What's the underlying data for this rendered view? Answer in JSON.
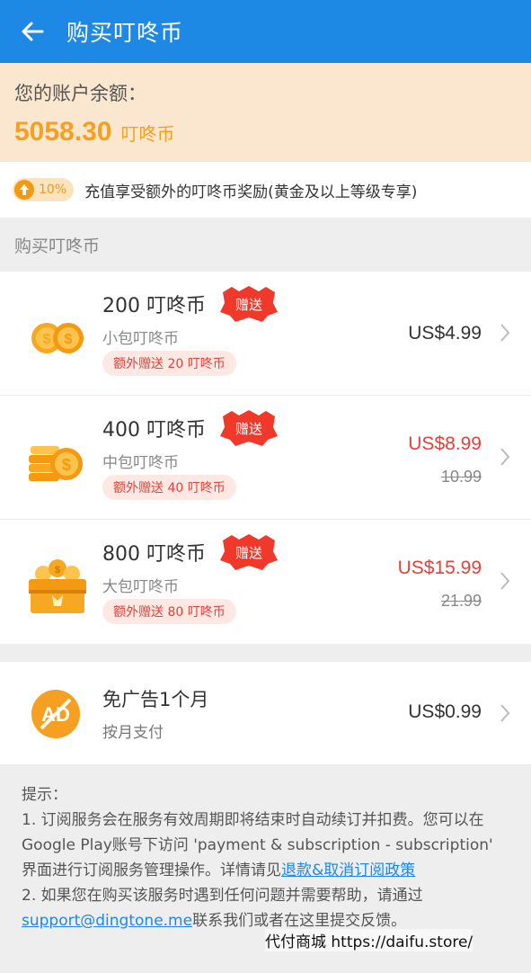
{
  "appbar": {
    "title": "购买叮咚币",
    "back_icon": "arrow-left-icon"
  },
  "balance": {
    "label": "您的账户余额：",
    "amount": "5058.30",
    "unit": "叮咚币"
  },
  "bonus": {
    "badge_percent": "10%",
    "badge_icon": "arrow-up-icon",
    "text": "充值享受额外的叮咚币奖励(黄金及以上等级专享)"
  },
  "section": {
    "title": "购买叮咚币"
  },
  "packages": [
    {
      "name": "200 叮咚币",
      "gift_label": "赠送",
      "subtitle": "小包叮咚币",
      "extra": "额外赠送 20 叮咚币",
      "price": "US$4.99",
      "old_price": "",
      "icon": "coins-small-icon"
    },
    {
      "name": "400 叮咚币",
      "gift_label": "赠送",
      "subtitle": "中包叮咚币",
      "extra": "额外赠送 40 叮咚币",
      "price": "US$8.99",
      "old_price": "10.99",
      "icon": "coin-stack-icon"
    },
    {
      "name": "800 叮咚币",
      "gift_label": "赠送",
      "subtitle": "大包叮咚币",
      "extra": "额外赠送 80 叮咚币",
      "price": "US$15.99",
      "old_price": "21.99",
      "icon": "treasure-chest-icon"
    }
  ],
  "adfree": {
    "name": "免广告1个月",
    "subtitle": "按月支付",
    "price": "US$0.99",
    "icon": "no-ad-icon",
    "icon_text": "AD"
  },
  "notes": {
    "title": "提示：",
    "line1": "1. 订阅服务会在服务有效周期即将结束时自动续订并扣费。您可以在Google Play账号下访问 'payment & subscription - subscription' 界面进行订阅服务管理操作。详情请见",
    "link1": "退款&取消订阅政策",
    "line2": "2. 如果您在购买该服务时遇到任何问题并需要帮助，请通过",
    "link2": "support@dingtone.me",
    "line2_end": "联系我们或者在这里提交反馈。"
  },
  "watermark": "代付商城 https://daifu.store/",
  "colors": {
    "appbar": "#1e88e5",
    "accent_orange": "#f5a020",
    "price_red": "#e0433a",
    "balance_bg": "#fbe7cf"
  }
}
